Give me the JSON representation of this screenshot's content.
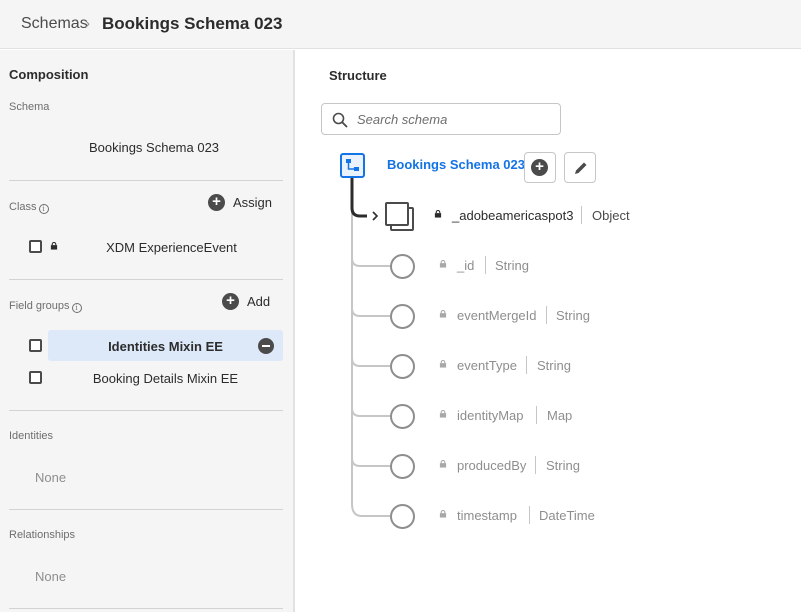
{
  "breadcrumb": {
    "parent": "Schemas",
    "separator": "›",
    "current": "Bookings Schema 023"
  },
  "composition": {
    "title": "Composition",
    "schema_label": "Schema",
    "schema_name": "Bookings Schema 023",
    "class_label": "Class",
    "assign_label": "Assign",
    "class_name": "XDM ExperienceEvent",
    "field_groups_label": "Field groups",
    "add_label": "Add",
    "field_groups": [
      {
        "name": "Identities Mixin EE",
        "selected": true
      },
      {
        "name": "Booking Details Mixin EE",
        "selected": false
      }
    ],
    "identities_label": "Identities",
    "identities_value": "None",
    "relationships_label": "Relationships",
    "relationships_value": "None"
  },
  "structure": {
    "title": "Structure",
    "search_placeholder": "Search schema",
    "root_name": "Bookings Schema 023",
    "object_field": {
      "name": "_adobeamericaspot3",
      "type": "Object"
    },
    "fields": [
      {
        "name": "_id",
        "type": "String"
      },
      {
        "name": "eventMergeId",
        "type": "String"
      },
      {
        "name": "eventType",
        "type": "String"
      },
      {
        "name": "identityMap",
        "type": "Map"
      },
      {
        "name": "producedBy",
        "type": "String"
      },
      {
        "name": "timestamp",
        "type": "DateTime"
      }
    ]
  },
  "colors": {
    "accent": "#1473e6",
    "selected_row": "#dde9f8",
    "panel_bg": "#f5f5f5"
  }
}
